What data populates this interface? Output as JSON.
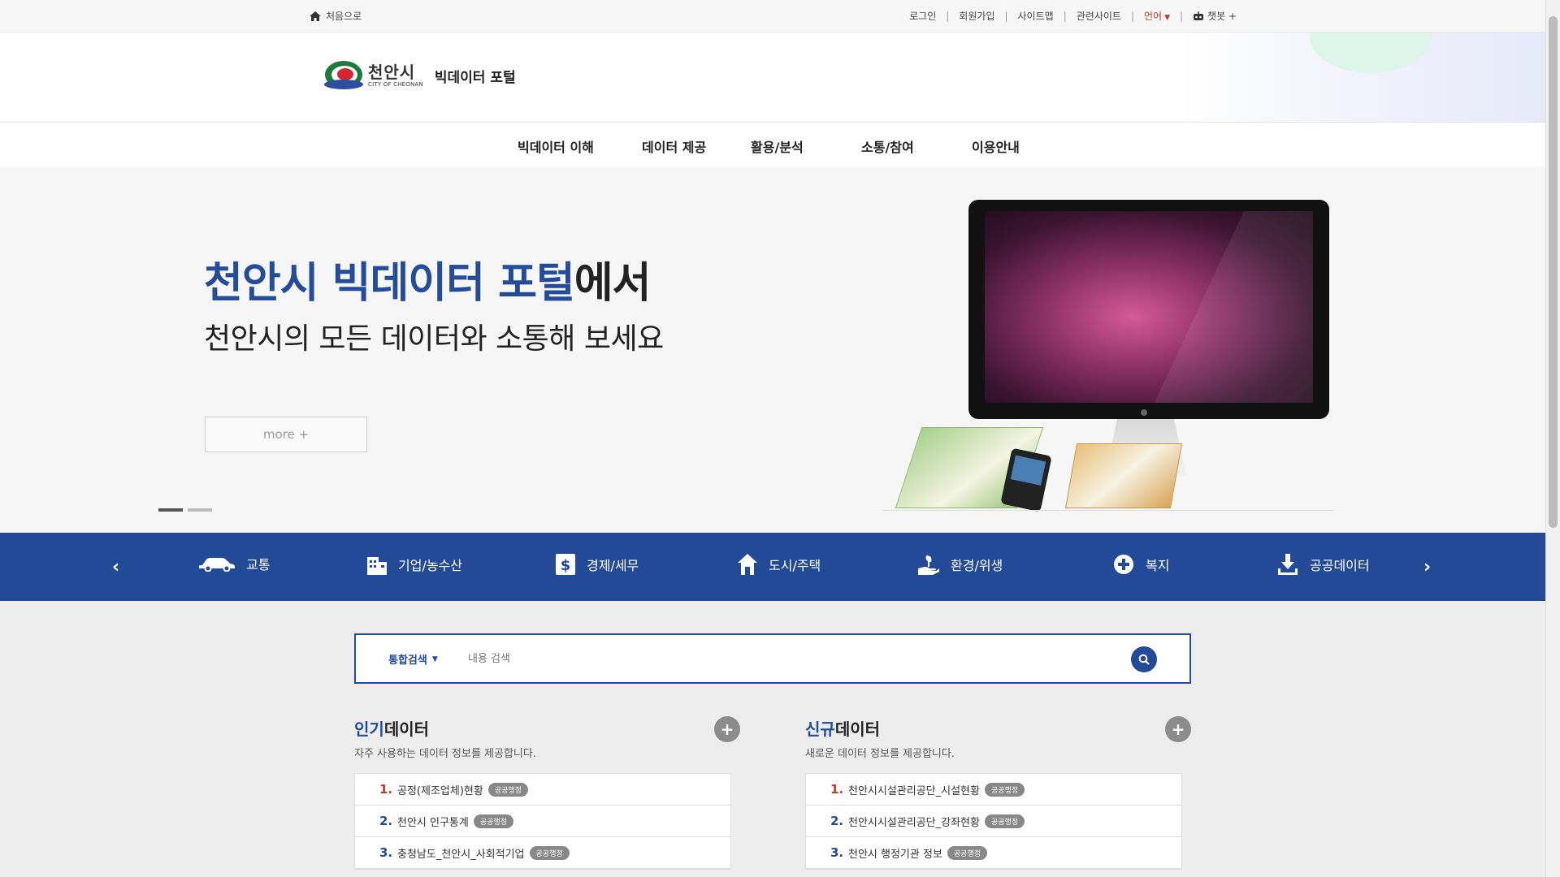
{
  "util": {
    "home": "처음으로",
    "links": [
      "로그인",
      "회원가입",
      "사이트맵",
      "관련사이트"
    ],
    "lang": "언어",
    "chatbot": "챗봇 +"
  },
  "header": {
    "logo_ko": "천안시",
    "logo_en": "CITY OF CHEONAN",
    "portal": "빅데이터 포털"
  },
  "gnb": [
    "빅데이터 이해",
    "데이터 제공",
    "활용/분석",
    "소통/참여",
    "이용안내"
  ],
  "hero": {
    "title_blue": "천안시 빅데이터 포털",
    "title_rest": "에서",
    "subtitle": "천안시의 모든 데이터와 소통해 보세요",
    "more": "more +"
  },
  "categories": [
    "교통",
    "기업/농수산",
    "경제/세무",
    "도시/주택",
    "환경/위생",
    "복지",
    "공공데이터"
  ],
  "search": {
    "scope": "통합검색",
    "placeholder": "내용 검색"
  },
  "popular": {
    "title_hl": "인기",
    "title_rest": "데이터",
    "sub": "자주 사용하는 데이터 정보를 제공합니다.",
    "items": [
      {
        "num": "1.",
        "name": "공정(제조업체)현황",
        "badge": "공공행정"
      },
      {
        "num": "2.",
        "name": "천안시 인구통계",
        "badge": "공공행정"
      },
      {
        "num": "3.",
        "name": "충청남도_천안시_사회적기업",
        "badge": "공공행정"
      }
    ]
  },
  "newdata": {
    "title_hl": "신규",
    "title_rest": "데이터",
    "sub": "새로운 데이터 정보를 제공합니다.",
    "items": [
      {
        "num": "1.",
        "name": "천안시시설관리공단_시설현황",
        "badge": "공공행정"
      },
      {
        "num": "2.",
        "name": "천안시시설관리공단_강좌현황",
        "badge": "공공행정"
      },
      {
        "num": "3.",
        "name": "천안시 행정기관 정보",
        "badge": "공공행정"
      }
    ]
  },
  "colors": {
    "primary": "#234a96",
    "accent_red": "#c0392b"
  }
}
